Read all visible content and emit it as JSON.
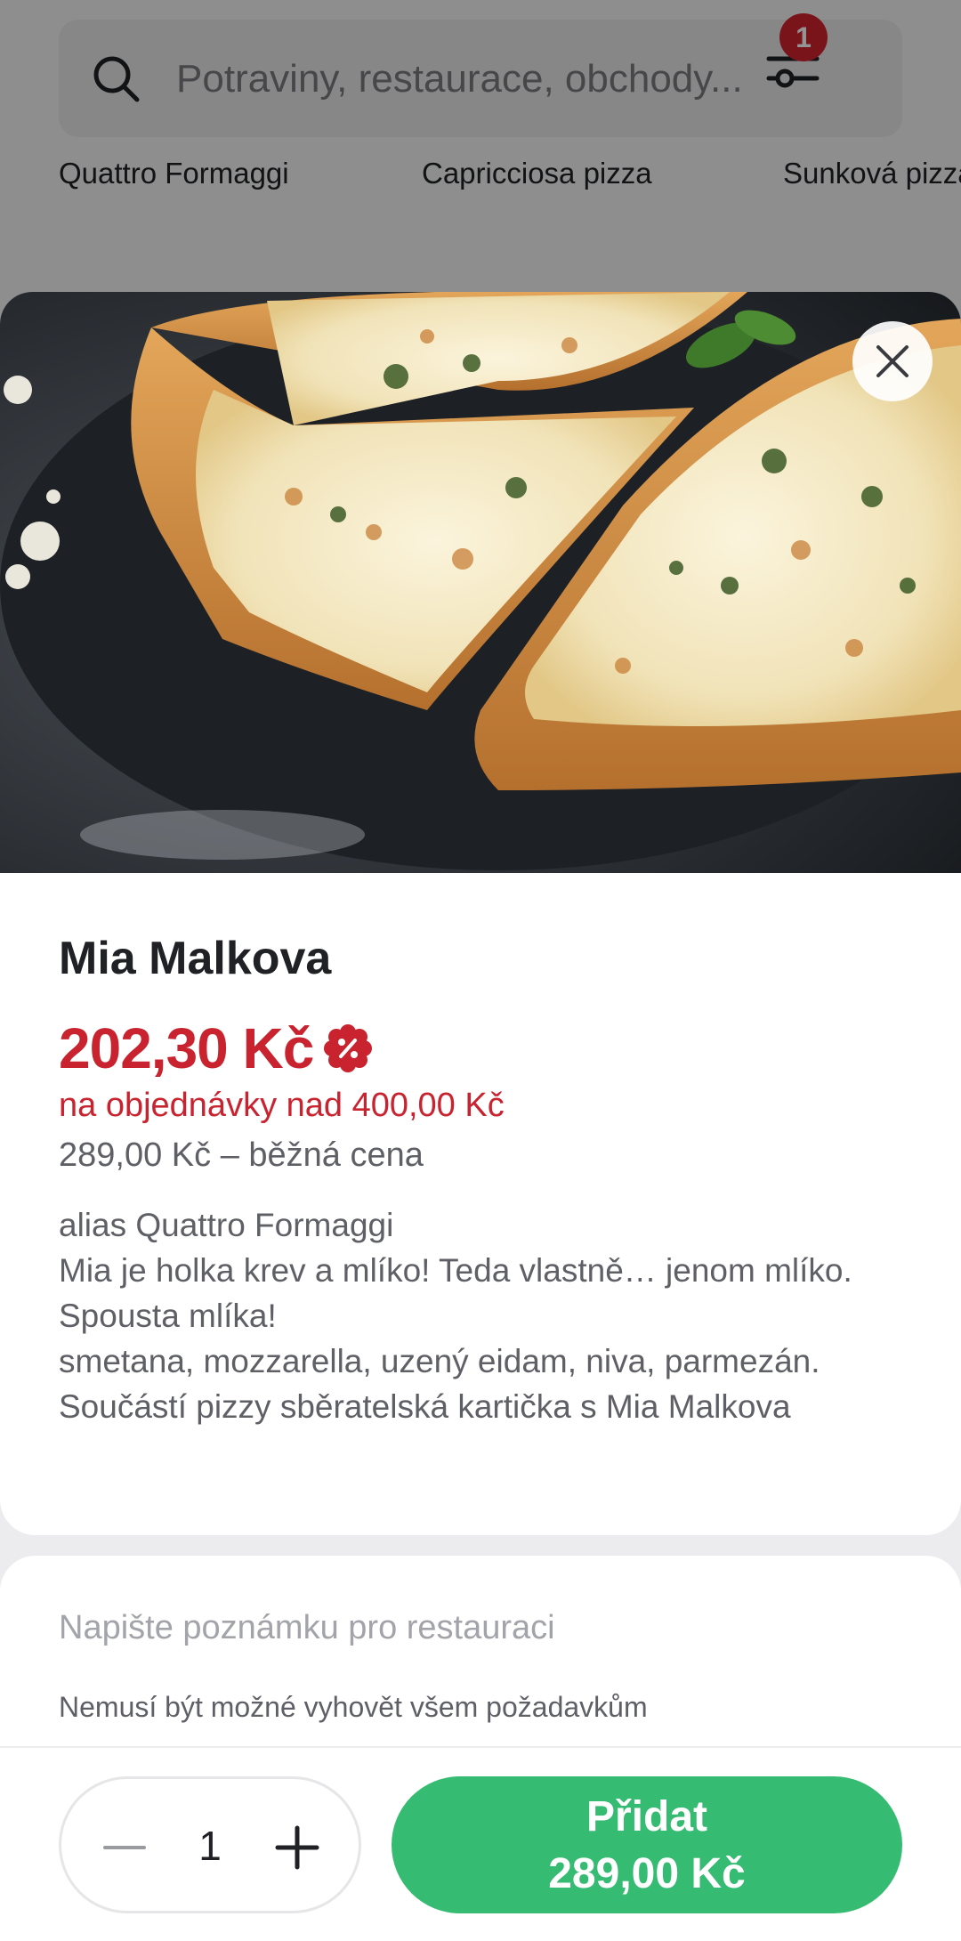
{
  "search": {
    "placeholder": "Potraviny, restaurace, obchody...",
    "filter_badge_count": "1"
  },
  "categories": [
    "Quattro Formaggi",
    "Capricciosa pizza",
    "Sunková pizza"
  ],
  "product": {
    "name": "Mia Malkova",
    "discount_price": "202,30 Kč",
    "discount_condition": "na objednávky nad 400,00 Kč",
    "regular_price": "289,00 Kč – běžná cena",
    "description": "alias Quattro Formaggi\nMia je holka krev a mlíko! Teda vlastně… jenom mlíko. Spousta mlíka!\nsmetana, mozzarella, uzený eidam, niva, parmezán. Součástí pizzy sběratelská kartička s Mia Malkova"
  },
  "note": {
    "placeholder": "Napište poznámku pro restauraci",
    "hint": "Nemusí být možné vyhovět všem požadavkům"
  },
  "order": {
    "quantity": "1",
    "add_label": "Přidat",
    "add_price": "289,00 Kč"
  },
  "icons": {
    "search": "search-icon",
    "filter": "filter-icon",
    "close": "close-icon",
    "promo": "discount-badge-icon",
    "minus": "minus-icon",
    "plus": "plus-icon"
  },
  "colors": {
    "accent_green": "#36bb72",
    "discount_red": "#c8232f",
    "badge_red": "#d0242f"
  }
}
